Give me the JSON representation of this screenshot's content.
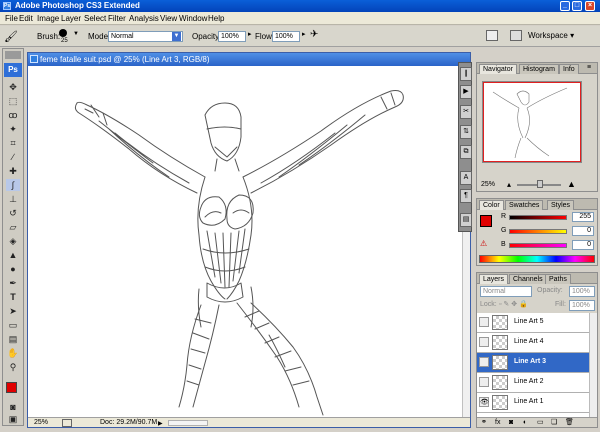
{
  "titlebar": {
    "app_title": "Adobe Photoshop CS3 Extended",
    "ps_mini": "Ps"
  },
  "menu": [
    "File",
    "Edit",
    "Image",
    "Layer",
    "Select",
    "Filter",
    "Analysis",
    "View",
    "Window",
    "Help"
  ],
  "options": {
    "brush_label": "Brush:",
    "brush_size": "25",
    "mode_label": "Mode:",
    "mode_value": "Normal",
    "opacity_label": "Opacity:",
    "opacity_value": "100%",
    "flow_label": "Flow:",
    "flow_value": "100%",
    "workspace_label": "Workspace ▾"
  },
  "toolbox": {
    "logo": "Ps"
  },
  "document": {
    "title": "feme fatalle suit.psd @ 25% (Line Art 3, RGB/8)",
    "zoom": "25%",
    "doc_info": "Doc: 29.2M/90.7M"
  },
  "navigator": {
    "tabs": [
      "Navigator",
      "Histogram",
      "Info"
    ],
    "zoom": "25%"
  },
  "color_panel": {
    "tabs": [
      "Color",
      "Swatches",
      "Styles"
    ],
    "r_label": "R",
    "g_label": "G",
    "b_label": "B",
    "r_value": "255",
    "g_value": "0",
    "b_value": "0",
    "foreground": "#e00000",
    "background": "#000000"
  },
  "layers_panel": {
    "tabs": [
      "Layers",
      "Channels",
      "Paths"
    ],
    "blend_mode": "Normal",
    "opacity_label": "Opacity:",
    "opacity_value": "100%",
    "lock_label": "Lock:",
    "fill_label": "Fill:",
    "fill_value": "100%",
    "layers": [
      {
        "name": "Line Art 5"
      },
      {
        "name": "Line Art 4"
      },
      {
        "name": "Line Art 3"
      },
      {
        "name": "Line Art 2"
      },
      {
        "name": "Line Art 1"
      }
    ]
  }
}
